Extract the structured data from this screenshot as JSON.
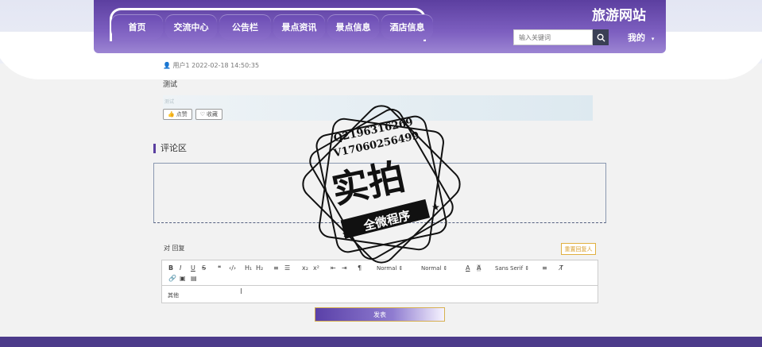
{
  "header": {
    "nav": [
      "首页",
      "交流中心",
      "公告栏",
      "景点资讯",
      "景点信息",
      "酒店信息"
    ],
    "site_title": "旅游网站",
    "search_placeholder": "输入关键词",
    "mine_label": "我的"
  },
  "post": {
    "meta": "用户1  2022-02-18 14:50:35",
    "text": "测试",
    "banner_label": "测试",
    "like_label": "点赞",
    "fav_label": "收藏"
  },
  "comments": {
    "section_title": "评论区",
    "reply_label": "对 回复",
    "reset_label": "重置回复人",
    "editor_text": "其他",
    "submit_label": "发表"
  },
  "toolbar": {
    "header_select": "Normal",
    "size_select": "Normal",
    "font_select": "Sans Serif"
  },
  "watermark": {
    "line1": "Q2196316269",
    "line2": "V17060256499",
    "main": "实拍",
    "ribbon": "全微程序"
  },
  "colors": {
    "primary": "#5c3fa0",
    "footer": "#4c3b8a",
    "accent_yellow": "#d9a030"
  }
}
